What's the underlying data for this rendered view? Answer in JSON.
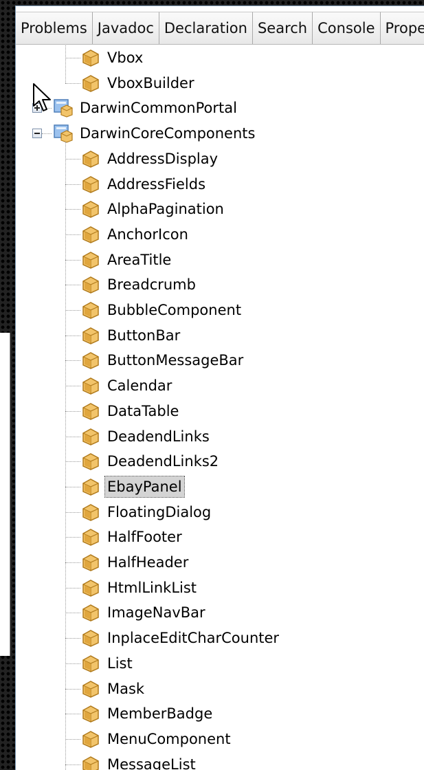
{
  "tabs": [
    {
      "label": "Problems"
    },
    {
      "label": "Javadoc"
    },
    {
      "label": "Declaration"
    },
    {
      "label": "Search"
    },
    {
      "label": "Console"
    },
    {
      "label": "Prope"
    }
  ],
  "tree": {
    "parent_items": [
      {
        "label": "Vbox",
        "icon": "package-folder-icon"
      },
      {
        "label": "VboxBuilder",
        "icon": "package-folder-icon"
      }
    ],
    "projects": [
      {
        "label": "DarwinCommonPortal",
        "expanded": false,
        "icon": "project-folder-icon"
      },
      {
        "label": "DarwinCoreComponents",
        "expanded": true,
        "icon": "project-folder-icon"
      }
    ],
    "children": [
      {
        "label": "AddressDisplay"
      },
      {
        "label": "AddressFields"
      },
      {
        "label": "AlphaPagination"
      },
      {
        "label": "AnchorIcon"
      },
      {
        "label": "AreaTitle"
      },
      {
        "label": "Breadcrumb"
      },
      {
        "label": "BubbleComponent"
      },
      {
        "label": "ButtonBar"
      },
      {
        "label": "ButtonMessageBar"
      },
      {
        "label": "Calendar"
      },
      {
        "label": "DataTable"
      },
      {
        "label": "DeadendLinks"
      },
      {
        "label": "DeadendLinks2"
      },
      {
        "label": "EbayPanel",
        "selected": true
      },
      {
        "label": "FloatingDialog"
      },
      {
        "label": "HalfFooter"
      },
      {
        "label": "HalfHeader"
      },
      {
        "label": "HtmlLinkList"
      },
      {
        "label": "ImageNavBar"
      },
      {
        "label": "InplaceEditCharCounter"
      },
      {
        "label": "List"
      },
      {
        "label": "Mask"
      },
      {
        "label": "MemberBadge"
      },
      {
        "label": "MenuComponent"
      },
      {
        "label": "MessageList"
      }
    ]
  },
  "colors": {
    "selection_bg": "#d4d4d4",
    "package_icon": "#e8b04a",
    "project_icon": "#6f9fd8"
  }
}
